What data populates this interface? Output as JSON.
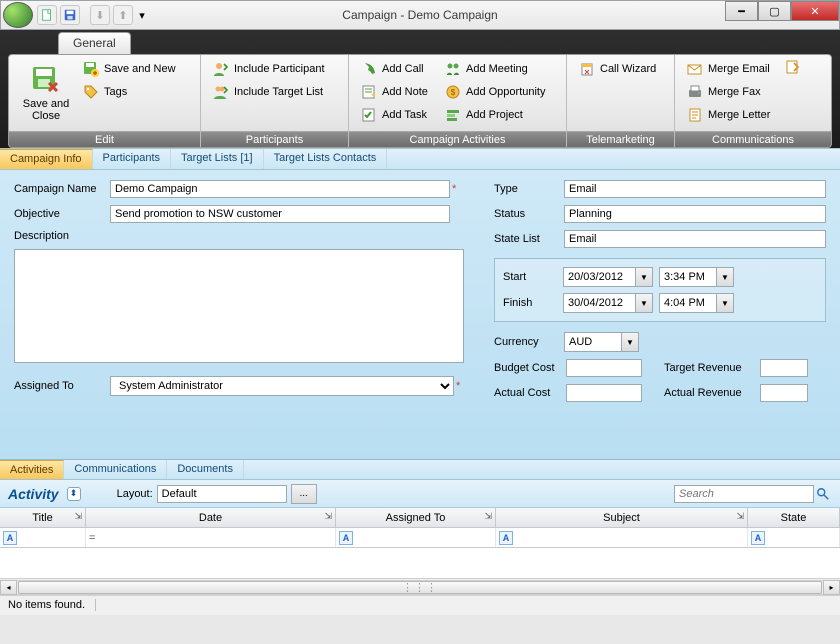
{
  "window": {
    "title": "Campaign - Demo Campaign"
  },
  "ribbon": {
    "tab": "General",
    "groups": {
      "edit": {
        "label": "Edit",
        "save_close": "Save and Close",
        "save_new": "Save and New",
        "tags": "Tags"
      },
      "participants": {
        "label": "Participants",
        "include_participant": "Include Participant",
        "include_target_list": "Include Target List"
      },
      "activities": {
        "label": "Campaign Activities",
        "add_call": "Add Call",
        "add_note": "Add Note",
        "add_task": "Add Task",
        "add_meeting": "Add Meeting",
        "add_opportunity": "Add Opportunity",
        "add_project": "Add Project"
      },
      "telemarketing": {
        "label": "Telemarketing",
        "call_wizard": "Call Wizard"
      },
      "communications": {
        "label": "Communications",
        "merge_email": "Merge Email",
        "merge_fax": "Merge Fax",
        "merge_letter": "Merge Letter"
      }
    }
  },
  "tabs": {
    "info": "Campaign Info",
    "participants": "Participants",
    "target_lists": "Target Lists [1]",
    "target_contacts": "Target Lists Contacts"
  },
  "form": {
    "labels": {
      "campaign_name": "Campaign Name",
      "objective": "Objective",
      "description": "Description",
      "assigned_to": "Assigned To",
      "type": "Type",
      "status": "Status",
      "state_list": "State List",
      "start": "Start",
      "finish": "Finish",
      "currency": "Currency",
      "budget_cost": "Budget Cost",
      "actual_cost": "Actual Cost",
      "target_revenue": "Target Revenue",
      "actual_revenue": "Actual Revenue"
    },
    "values": {
      "campaign_name": "Demo Campaign",
      "objective": "Send promotion to NSW customer",
      "description": "",
      "assigned_to": "System Administrator",
      "type": "Email",
      "status": "Planning",
      "state_list": "Email",
      "start_date": "20/03/2012",
      "start_time": "3:34 PM",
      "finish_date": "30/04/2012",
      "finish_time": "4:04 PM",
      "currency": "AUD",
      "budget_cost": "",
      "actual_cost": "",
      "target_revenue": "",
      "actual_revenue": ""
    }
  },
  "lower_tabs": {
    "activities": "Activities",
    "communications": "Communications",
    "documents": "Documents"
  },
  "activity": {
    "title": "Activity",
    "layout_label": "Layout:",
    "layout_value": "Default",
    "search_placeholder": "Search",
    "columns": {
      "title": "Title",
      "date": "Date",
      "assigned_to": "Assigned To",
      "subject": "Subject",
      "state": "State"
    },
    "filter_eq": "=",
    "footer": "No items found."
  }
}
